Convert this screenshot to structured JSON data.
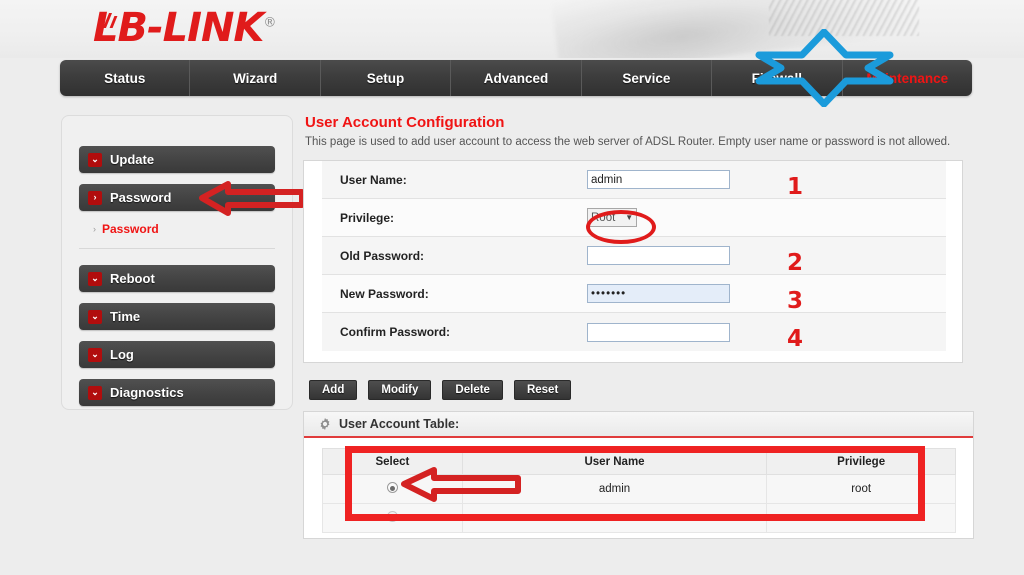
{
  "brand": {
    "name": "LB-LINK",
    "registered": "®",
    "logo_color": "#e01b1b"
  },
  "nav": {
    "items": [
      {
        "label": "Status",
        "active": false
      },
      {
        "label": "Wizard",
        "active": false
      },
      {
        "label": "Setup",
        "active": false
      },
      {
        "label": "Advanced",
        "active": false
      },
      {
        "label": "Service",
        "active": false
      },
      {
        "label": "Firewall",
        "active": false
      },
      {
        "label": "Maintenance",
        "active": true
      }
    ],
    "active_color": "#f01414",
    "star_highlight_color": "#1b9bdb"
  },
  "sidebar": {
    "top_items": [
      {
        "label": "Update",
        "chevron": "chevron-down",
        "glyph": "⌄"
      },
      {
        "label": "Password",
        "chevron": "chevron-right",
        "glyph": "›"
      }
    ],
    "sub_items": [
      {
        "label": "Password",
        "chevron_glyph": "›"
      }
    ],
    "bottom_items": [
      {
        "label": "Reboot",
        "chevron": "chevron-down",
        "glyph": "⌄"
      },
      {
        "label": "Time",
        "chevron": "chevron-down",
        "glyph": "⌄"
      },
      {
        "label": "Log",
        "chevron": "chevron-down",
        "glyph": "⌄"
      },
      {
        "label": "Diagnostics",
        "chevron": "chevron-down",
        "glyph": "⌄"
      }
    ]
  },
  "main": {
    "title": "User Account Configuration",
    "description": "This page is used to add user account to access the web server of ADSL Router. Empty user name or password is not allowed.",
    "form_rows": [
      {
        "label": "User Name:",
        "type": "text",
        "value": "admin",
        "annotation": "1"
      },
      {
        "label": "Privilege:",
        "type": "select",
        "value": "Root",
        "caret": "▼",
        "annotation": ""
      },
      {
        "label": "Old Password:",
        "type": "password",
        "value": "",
        "annotation": "2"
      },
      {
        "label": "New Password:",
        "type": "password",
        "value": "•••••••",
        "annotation": "3"
      },
      {
        "label": "Confirm Password:",
        "type": "password",
        "value": "",
        "annotation": "4"
      }
    ],
    "buttons": [
      {
        "label": "Add"
      },
      {
        "label": "Modify"
      },
      {
        "label": "Delete"
      },
      {
        "label": "Reset"
      }
    ]
  },
  "table": {
    "section_title": "User Account Table:",
    "gear_icon": "gear-icon",
    "columns": [
      "Select",
      "User Name",
      "Privilege"
    ],
    "rows": [
      {
        "selected": true,
        "user_name": "admin",
        "privilege": "root"
      },
      {
        "selected": false,
        "user_name": "",
        "privilege": ""
      }
    ]
  },
  "annotations": {
    "arrow_color": "#ef2222",
    "ellipse_color": "#e01b1b",
    "rect_color": "#ef2222",
    "star_color": "#1b9bdb",
    "numbers": [
      "1",
      "2",
      "3",
      "4"
    ]
  }
}
